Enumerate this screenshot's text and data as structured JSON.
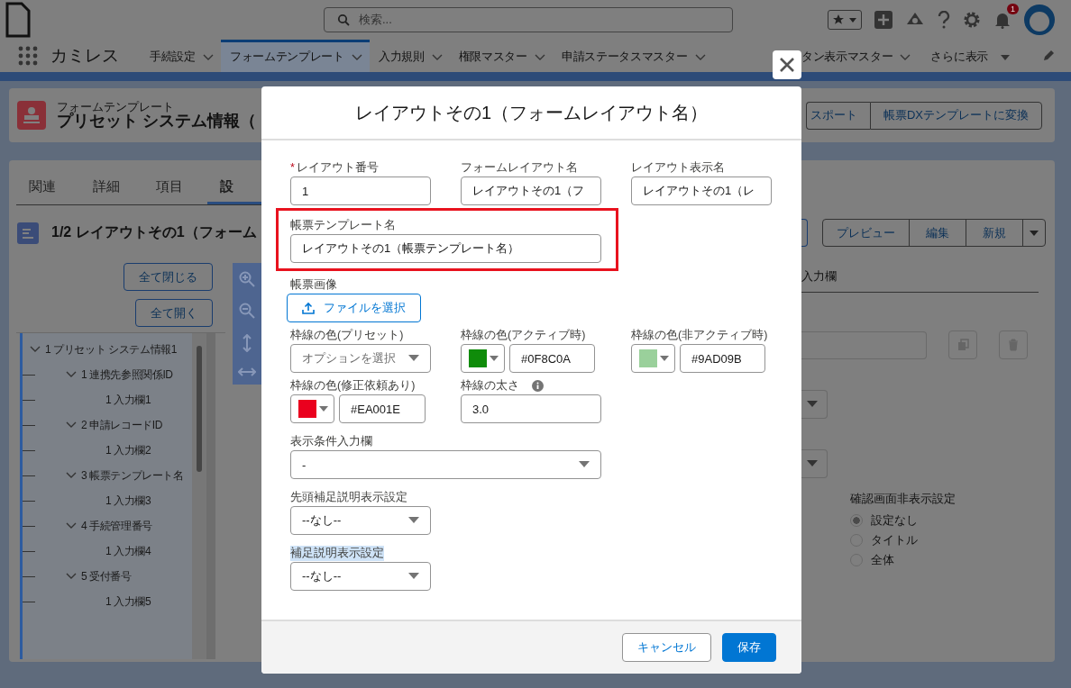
{
  "header": {
    "search": {
      "placeholder": "検索..."
    },
    "notifications": "1"
  },
  "nav": {
    "app_name": "カミレス",
    "tabs": [
      {
        "label": "手続設定",
        "selected": false
      },
      {
        "label": "フォームテンプレート",
        "selected": true
      },
      {
        "label": "入力規則",
        "selected": false
      },
      {
        "label": "権限マスター",
        "selected": false
      },
      {
        "label": "申請ステータスマスター",
        "selected": false
      },
      {
        "label": "タン表示マスター",
        "selected": false
      }
    ],
    "more": "さらに表示"
  },
  "record": {
    "object_type": "フォームテンプレート",
    "title": "プリセット システム情報（",
    "actions": [
      "スポート",
      "帳票DXテンプレートに変換"
    ]
  },
  "detail_tabs": [
    {
      "label": "関連",
      "selected": false
    },
    {
      "label": "詳細",
      "selected": false
    },
    {
      "label": "項目",
      "selected": false
    },
    {
      "label": "設",
      "selected": true
    }
  ],
  "layout_heading": "1/2 レイアウトその1（フォーム",
  "tree_buttons": [
    "全て閉じる",
    "全て開く"
  ],
  "tree": [
    {
      "label": "1 プリセット システム情報1",
      "expanded": true,
      "children": [
        {
          "label": "1 連携先参照関係ID",
          "expanded": true,
          "children": [
            {
              "label": "1 入力欄1"
            }
          ]
        },
        {
          "label": "2 申請レコードID",
          "expanded": true,
          "children": [
            {
              "label": "1 入力欄2"
            }
          ]
        },
        {
          "label": "3 帳票テンプレート名",
          "expanded": true,
          "children": [
            {
              "label": "1 入力欄3"
            }
          ]
        },
        {
          "label": "4 手続管理番号",
          "expanded": true,
          "children": [
            {
              "label": "1 入力欄4"
            }
          ]
        },
        {
          "label": "5 受付番号",
          "expanded": true,
          "children": [
            {
              "label": "1 入力欄5"
            }
          ]
        }
      ]
    }
  ],
  "layout_actions": [
    "プレビュー",
    "編集",
    "新規"
  ],
  "section_tab": "入力欄",
  "confirm_setting": {
    "label": "確認画面非表示設定",
    "options": [
      {
        "label": "設定なし",
        "selected": true
      },
      {
        "label": "タイトル",
        "selected": false
      },
      {
        "label": "全体",
        "selected": false
      }
    ]
  },
  "modal": {
    "title": "レイアウトその1（フォームレイアウト名）",
    "rows": [
      [
        {
          "kind": "text",
          "label": "レイアウト番号",
          "required_mark": "*",
          "value": "1"
        },
        {
          "kind": "text",
          "label": "フォームレイアウト名",
          "value": "レイアウトその1（フ"
        },
        {
          "kind": "text",
          "label": "レイアウト表示名",
          "value": "レイアウトその1（レ"
        }
      ],
      [
        {
          "kind": "text",
          "label": "帳票テンプレート名",
          "value": "レイアウトその1（帳票テンプレート名）",
          "highlighted": true
        }
      ],
      [
        {
          "kind": "file",
          "label": "帳票画像",
          "value": "ファイルを選択"
        }
      ],
      [
        {
          "kind": "select",
          "label": "枠線の色(プリセット)",
          "placeholder": "オプションを選択",
          "label_selected": false
        },
        {
          "kind": "color",
          "label": "枠線の色(アクティブ時)",
          "color": "#0f8c0a",
          "value": "#0F8C0A"
        },
        {
          "kind": "color",
          "label": "枠線の色(非アクティブ時)",
          "color": "#9ad09b",
          "value": "#9AD09B"
        }
      ],
      [
        {
          "kind": "color",
          "label": "枠線の色(修正依頼あり)",
          "color": "#ea001e",
          "value": "#EA001E"
        },
        {
          "kind": "text",
          "label": "枠線の太さ",
          "value": "3.0",
          "help": true
        }
      ],
      [
        {
          "kind": "select",
          "label": "表示条件入力欄",
          "value": "-",
          "label_selected": false
        }
      ],
      [
        {
          "kind": "select",
          "label": "先頭補足説明表示設定",
          "value": "--なし--",
          "label_selected": false
        }
      ],
      [
        {
          "kind": "select",
          "label": "補足説明表示設定",
          "value": "--なし--",
          "label_selected": true
        }
      ]
    ],
    "buttons": [
      {
        "label": "キャンセル",
        "kind": "neutral"
      },
      {
        "label": "保存",
        "kind": "brand"
      }
    ]
  }
}
